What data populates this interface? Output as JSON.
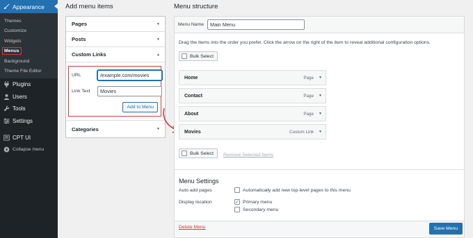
{
  "admin_menu": {
    "appearance": "Appearance",
    "submenu": [
      "Themes",
      "Customize",
      "Widgets",
      "Menus",
      "Background",
      "Theme File Editor"
    ],
    "items": [
      "Plugins",
      "Users",
      "Tools",
      "Settings",
      "CPT UI"
    ],
    "collapse": "Collapse menu"
  },
  "add_items": {
    "heading": "Add menu items",
    "pages": "Pages",
    "posts": "Posts",
    "custom_links": "Custom Links",
    "url_label": "URL",
    "url_value": "/example.com/movies",
    "link_text_label": "Link Text",
    "link_text_value": "Movies",
    "add_button": "Add to Menu",
    "categories": "Categories"
  },
  "structure": {
    "heading": "Menu structure",
    "menu_name_label": "Menu Name",
    "menu_name_value": "Main Menu",
    "instructions": "Drag the items into the order you prefer. Click the arrow on the right of the item to reveal additional configuration options.",
    "bulk_select": "Bulk Select",
    "items": [
      {
        "title": "Home",
        "type": "Page"
      },
      {
        "title": "Contact",
        "type": "Page"
      },
      {
        "title": "About",
        "type": "Page"
      },
      {
        "title": "Movies",
        "type": "Custom Link"
      }
    ],
    "remove_selected": "Remove Selected Items"
  },
  "settings": {
    "title": "Menu Settings",
    "auto_add_label": "Auto add pages",
    "auto_add_option": "Automatically add new top-level pages to this menu",
    "display_location_label": "Display location",
    "primary_menu": "Primary menu",
    "primary_checked": true,
    "secondary_menu": "Secondary menu",
    "secondary_checked": false
  },
  "footer": {
    "delete": "Delete Menu",
    "save": "Save Menu"
  },
  "colors": {
    "accent": "#2271b1",
    "sidebar": "#1d2327",
    "highlight": "#d63638"
  }
}
